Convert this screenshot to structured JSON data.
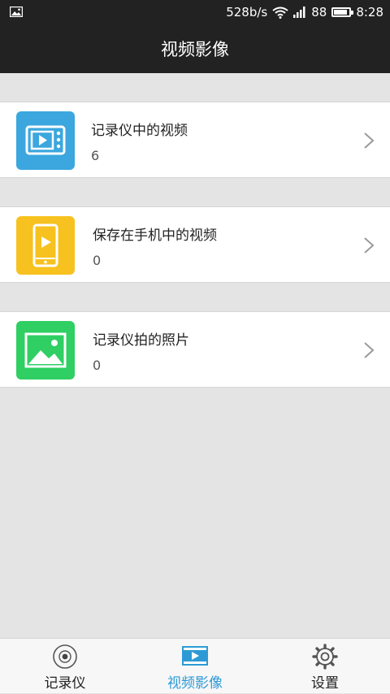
{
  "status_bar": {
    "speed": "528b/s",
    "battery": "88",
    "battery_level": 0.88,
    "time": "8:28"
  },
  "header": {
    "title": "视频影像"
  },
  "items": [
    {
      "title": "记录仪中的视频",
      "count": "6",
      "icon": "tv-play-icon",
      "color": "#3ba7de"
    },
    {
      "title": "保存在手机中的视频",
      "count": "0",
      "icon": "phone-play-icon",
      "color": "#f7c21f"
    },
    {
      "title": "记录仪拍的照片",
      "count": "0",
      "icon": "photo-icon",
      "color": "#2fcf63"
    }
  ],
  "tabs": [
    {
      "label": "记录仪",
      "icon": "camera-icon",
      "active": false
    },
    {
      "label": "视频影像",
      "icon": "video-icon",
      "active": true
    },
    {
      "label": "设置",
      "icon": "gear-icon",
      "active": false
    }
  ],
  "colors": {
    "accent": "#2d9ad6",
    "bar": "#222222",
    "background": "#e4e4e4"
  }
}
